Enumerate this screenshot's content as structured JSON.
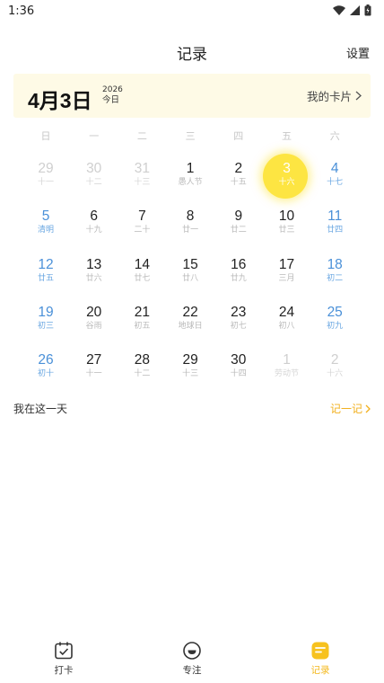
{
  "status": {
    "time": "1:36"
  },
  "header": {
    "title": "记录",
    "settings": "设置"
  },
  "banner": {
    "date": "4月3日",
    "year": "2026",
    "today": "今日",
    "cards": "我的卡片"
  },
  "weekdays": [
    "日",
    "一",
    "二",
    "三",
    "四",
    "五",
    "六"
  ],
  "calendar": [
    [
      {
        "n": "29",
        "l": "十一",
        "t": "other"
      },
      {
        "n": "30",
        "l": "十二",
        "t": "other"
      },
      {
        "n": "31",
        "l": "十三",
        "t": "other"
      },
      {
        "n": "1",
        "l": "愚人节",
        "t": ""
      },
      {
        "n": "2",
        "l": "十五",
        "t": ""
      },
      {
        "n": "3",
        "l": "十六",
        "t": "sel"
      },
      {
        "n": "4",
        "l": "十七",
        "t": "wk"
      }
    ],
    [
      {
        "n": "5",
        "l": "清明",
        "t": "wk"
      },
      {
        "n": "6",
        "l": "十九",
        "t": ""
      },
      {
        "n": "7",
        "l": "二十",
        "t": ""
      },
      {
        "n": "8",
        "l": "廿一",
        "t": ""
      },
      {
        "n": "9",
        "l": "廿二",
        "t": ""
      },
      {
        "n": "10",
        "l": "廿三",
        "t": ""
      },
      {
        "n": "11",
        "l": "廿四",
        "t": "wk"
      }
    ],
    [
      {
        "n": "12",
        "l": "廿五",
        "t": "wk"
      },
      {
        "n": "13",
        "l": "廿六",
        "t": ""
      },
      {
        "n": "14",
        "l": "廿七",
        "t": ""
      },
      {
        "n": "15",
        "l": "廿八",
        "t": ""
      },
      {
        "n": "16",
        "l": "廿九",
        "t": ""
      },
      {
        "n": "17",
        "l": "三月",
        "t": ""
      },
      {
        "n": "18",
        "l": "初二",
        "t": "wk"
      }
    ],
    [
      {
        "n": "19",
        "l": "初三",
        "t": "wk"
      },
      {
        "n": "20",
        "l": "谷雨",
        "t": ""
      },
      {
        "n": "21",
        "l": "初五",
        "t": ""
      },
      {
        "n": "22",
        "l": "地球日",
        "t": ""
      },
      {
        "n": "23",
        "l": "初七",
        "t": ""
      },
      {
        "n": "24",
        "l": "初八",
        "t": ""
      },
      {
        "n": "25",
        "l": "初九",
        "t": "wk"
      }
    ],
    [
      {
        "n": "26",
        "l": "初十",
        "t": "wk"
      },
      {
        "n": "27",
        "l": "十一",
        "t": ""
      },
      {
        "n": "28",
        "l": "十二",
        "t": ""
      },
      {
        "n": "29",
        "l": "十三",
        "t": ""
      },
      {
        "n": "30",
        "l": "十四",
        "t": ""
      },
      {
        "n": "1",
        "l": "劳动节",
        "t": "other"
      },
      {
        "n": "2",
        "l": "十六",
        "t": "other"
      }
    ]
  ],
  "onthisday": {
    "label": "我在这一天",
    "action": "记一记"
  },
  "tabs": [
    {
      "label": "打卡",
      "icon": "checkin-calendar-icon"
    },
    {
      "label": "专注",
      "icon": "focus-face-icon"
    },
    {
      "label": "记录",
      "icon": "record-note-icon",
      "active": true
    }
  ],
  "colors": {
    "accent": "#fde542",
    "weekend": "#4a90d8",
    "action": "#f2b01e",
    "banner": "#fefae6"
  }
}
